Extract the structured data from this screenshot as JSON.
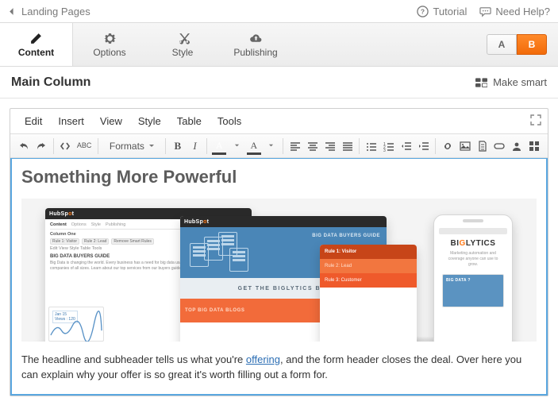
{
  "topbar": {
    "back_label": "Landing Pages",
    "tutorial_label": "Tutorial",
    "help_label": "Need Help?"
  },
  "tabs": {
    "content": "Content",
    "options": "Options",
    "style": "Style",
    "publishing": "Publishing"
  },
  "ab": {
    "a": "A",
    "b": "B"
  },
  "section": {
    "title": "Main Column",
    "make_smart": "Make smart"
  },
  "menus": {
    "edit": "Edit",
    "insert": "Insert",
    "view": "View",
    "style": "Style",
    "table": "Table",
    "tools": "Tools"
  },
  "toolbar": {
    "formats": "Formats"
  },
  "content": {
    "headline": "Something More Powerful",
    "body_pre": "The headline and subheader tells us what you're ",
    "body_link": "offering",
    "body_post": ", and the form header closes the deal. Over here you can explain why your offer is so great it's worth filling out a form for."
  },
  "hero": {
    "hubspot": "HubSp",
    "hubspot_o": "o",
    "hubspot_t": "t",
    "p1": {
      "tabs": [
        "Content",
        "Options",
        "Style",
        "Publishing"
      ],
      "col": "Column One",
      "rule1": "Rule 1: Visitor",
      "rule2": "Rule 2: Lead",
      "remove": "Remove Smart Rules",
      "menus": "Edit  View  Style  Table  Tools",
      "h": "BIG DATA BUYERS GUIDE",
      "tip1": "Jan 15",
      "tip2": "Views : 120"
    },
    "p2": {
      "title": "BIG DATA BUYERS GUIDE",
      "mid": "GET THE BIGLYTICS BIG",
      "bot": "TOP BIG DATA BLOGS"
    },
    "p3": {
      "head": "Rule 1: Visitor",
      "r2": "Rule 2: Lead",
      "r3": "Rule 3: Customer"
    },
    "phone": {
      "brand_pre": "BI",
      "brand_mid": "G",
      "brand_post": "LYTICS",
      "card": "BIG DATA ?"
    }
  }
}
